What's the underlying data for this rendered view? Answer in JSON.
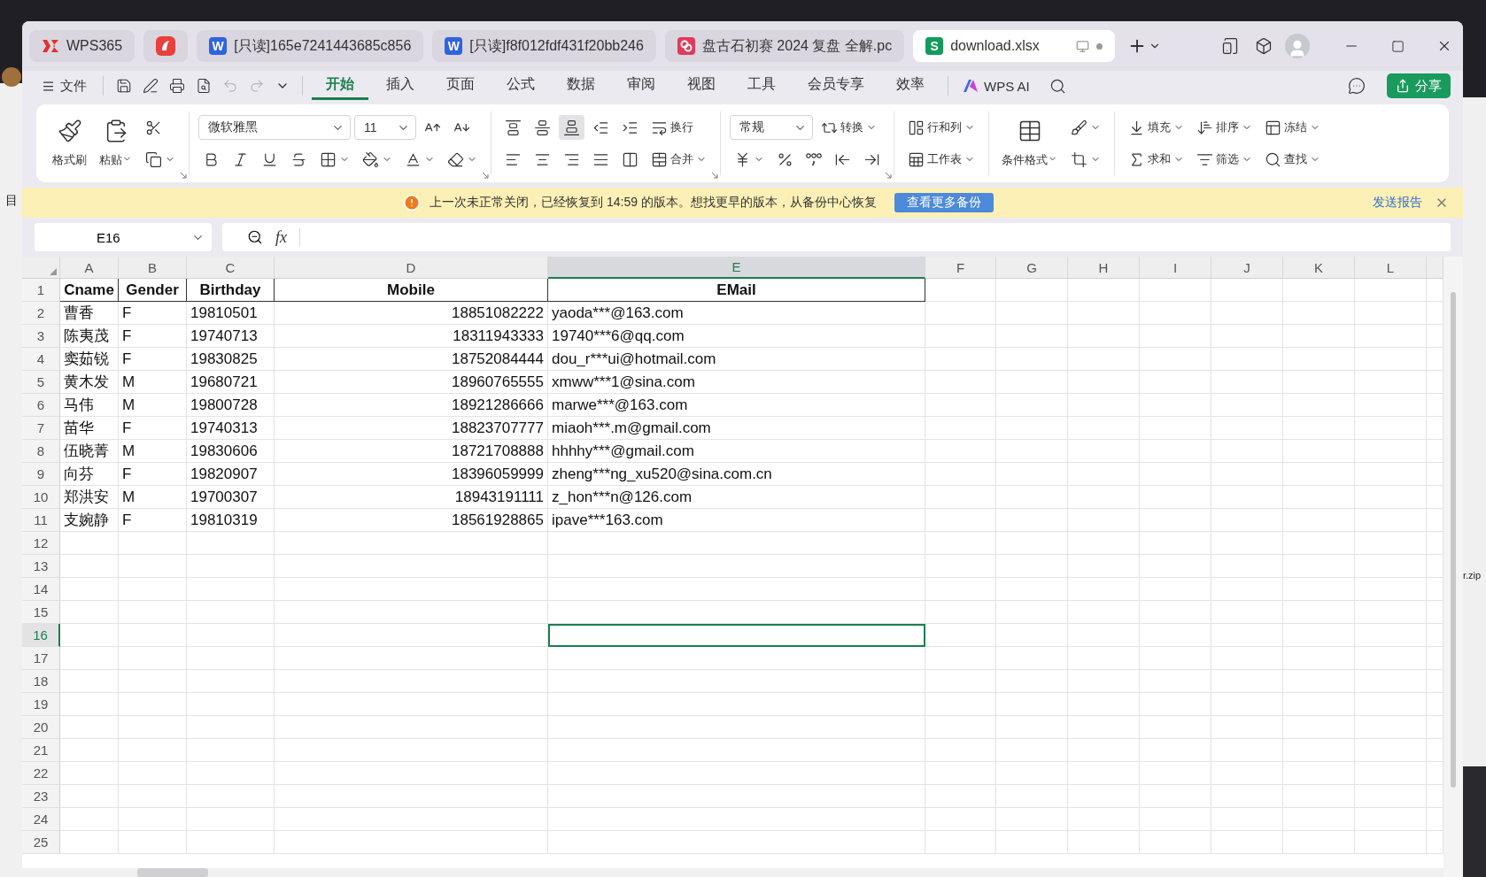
{
  "background": {
    "left_text": "目",
    "right_text": "r.zip"
  },
  "tabs": [
    {
      "kind": "home",
      "label": "WPS365",
      "selected": false
    },
    {
      "kind": "app",
      "selected": false
    },
    {
      "kind": "writer",
      "badge": "W",
      "label": "[只读]165e7241443685c856",
      "selected": false
    },
    {
      "kind": "writer",
      "badge": "W",
      "label": "[只读]f8f012fdf431f20bb246",
      "selected": false
    },
    {
      "kind": "pdf",
      "label": "盘古石初赛 2024 复盘 全解.pc",
      "selected": false
    },
    {
      "kind": "sheet",
      "badge": "S",
      "label": "download.xlsx",
      "selected": true
    }
  ],
  "menu": {
    "file": "文件",
    "items": [
      {
        "label": "开始",
        "selected": true
      },
      {
        "label": "插入",
        "selected": false
      },
      {
        "label": "页面",
        "selected": false
      },
      {
        "label": "公式",
        "selected": false
      },
      {
        "label": "数据",
        "selected": false
      },
      {
        "label": "审阅",
        "selected": false
      },
      {
        "label": "视图",
        "selected": false
      },
      {
        "label": "工具",
        "selected": false
      },
      {
        "label": "会员专享",
        "selected": false
      },
      {
        "label": "效率",
        "selected": false
      }
    ],
    "ai": "WPS AI",
    "share": "分享"
  },
  "ribbon": [
    {
      "launcher": true,
      "large": [
        {
          "label": "格式刷",
          "dropdown": false
        },
        {
          "label": "粘贴",
          "dropdown": true
        }
      ],
      "top": [
        {
          "kind": "button",
          "dropdown": false
        }
      ],
      "bottom": [
        {
          "kind": "button",
          "dropdown": true
        }
      ]
    },
    {
      "launcher": true,
      "top": [
        {
          "kind": "select",
          "value": "微软雅黑"
        },
        {
          "kind": "select",
          "value": "11"
        },
        {
          "kind": "button",
          "dropdown": false
        },
        {
          "kind": "button",
          "dropdown": false
        }
      ],
      "bottom": [
        {
          "kind": "button",
          "dropdown": false
        },
        {
          "kind": "button",
          "dropdown": false
        },
        {
          "kind": "button",
          "dropdown": false
        },
        {
          "kind": "button",
          "dropdown": false
        },
        {
          "kind": "button",
          "dropdown": true
        },
        {
          "kind": "button",
          "dropdown": true
        },
        {
          "kind": "button",
          "dropdown": true
        },
        {
          "kind": "button",
          "dropdown": true
        }
      ]
    },
    {
      "launcher": true,
      "top": [
        {
          "kind": "button",
          "dropdown": false,
          "selected": false
        },
        {
          "kind": "button",
          "dropdown": false,
          "selected": false
        },
        {
          "kind": "button",
          "dropdown": false,
          "selected": true
        },
        {
          "kind": "button",
          "dropdown": false
        },
        {
          "kind": "button",
          "dropdown": false
        },
        {
          "kind": "button",
          "label": "换行",
          "dropdown": false
        }
      ],
      "bottom": [
        {
          "kind": "button",
          "dropdown": false
        },
        {
          "kind": "button",
          "dropdown": false
        },
        {
          "kind": "button",
          "dropdown": false
        },
        {
          "kind": "button",
          "dropdown": false
        },
        {
          "kind": "button",
          "dropdown": false
        },
        {
          "kind": "button",
          "label": "合并",
          "dropdown": true
        }
      ]
    },
    {
      "launcher": true,
      "top": [
        {
          "kind": "select",
          "value": "常规"
        },
        {
          "kind": "button",
          "label": "转换",
          "dropdown": true
        }
      ],
      "bottom": [
        {
          "kind": "button",
          "dropdown": true
        },
        {
          "kind": "button",
          "dropdown": false
        },
        {
          "kind": "button",
          "dropdown": false
        },
        {
          "kind": "button",
          "dropdown": false
        },
        {
          "kind": "button",
          "dropdown": false
        }
      ]
    },
    {
      "launcher": false,
      "top": [
        {
          "kind": "button",
          "label": "行和列",
          "dropdown": true
        }
      ],
      "bottom": [
        {
          "kind": "button",
          "label": "工作表",
          "dropdown": true
        }
      ]
    },
    {
      "launcher": false,
      "large": [
        {
          "label": "条件格式",
          "dropdown": true
        }
      ],
      "top": [
        {
          "kind": "button",
          "dropdown": true
        }
      ],
      "bottom": [
        {
          "kind": "button",
          "dropdown": true
        }
      ]
    },
    {
      "launcher": false,
      "top": [
        {
          "kind": "button",
          "label": "填充",
          "dropdown": true
        },
        {
          "kind": "button",
          "label": "排序",
          "dropdown": true
        },
        {
          "kind": "button",
          "label": "冻结",
          "dropdown": true
        }
      ],
      "bottom": [
        {
          "kind": "button",
          "label": "求和",
          "dropdown": true
        },
        {
          "kind": "button",
          "label": "筛选",
          "dropdown": true
        },
        {
          "kind": "button",
          "label": "查找",
          "dropdown": true
        }
      ]
    }
  ],
  "notice": {
    "text": "上一次未正常关闭，已经恢复到 14:59 的版本。想找更早的版本，从备份中心恢复",
    "button": "查看更多备份",
    "link": "发送报告"
  },
  "formula_bar": {
    "name_box": "E16",
    "fx": "fx"
  },
  "sheet": {
    "columns": [
      {
        "label": "A",
        "selected": false
      },
      {
        "label": "B",
        "selected": false
      },
      {
        "label": "C",
        "selected": false
      },
      {
        "label": "D",
        "selected": false
      },
      {
        "label": "E",
        "selected": true
      },
      {
        "label": "F",
        "selected": false
      },
      {
        "label": "G",
        "selected": false
      },
      {
        "label": "H",
        "selected": false
      },
      {
        "label": "I",
        "selected": false
      },
      {
        "label": "J",
        "selected": false
      },
      {
        "label": "K",
        "selected": false
      },
      {
        "label": "L",
        "selected": false
      }
    ],
    "rows": [
      {
        "number": "1",
        "kind": "header",
        "selected": false,
        "cells": [
          "Cname",
          "Gender",
          "Birthday",
          "Mobile",
          "EMail"
        ]
      },
      {
        "number": "2",
        "kind": "data",
        "selected": false,
        "cells": [
          "曹香",
          "F",
          "19810501",
          "18851082222",
          "yaoda***@163.com"
        ]
      },
      {
        "number": "3",
        "kind": "data",
        "selected": false,
        "cells": [
          "陈夷茂",
          "F",
          "19740713",
          "18311943333",
          "19740***6@qq.com"
        ]
      },
      {
        "number": "4",
        "kind": "data",
        "selected": false,
        "cells": [
          "窦茹锐",
          "F",
          "19830825",
          "18752084444",
          "dou_r***ui@hotmail.com"
        ]
      },
      {
        "number": "5",
        "kind": "data",
        "selected": false,
        "cells": [
          "黄木发",
          "M",
          "19680721",
          "18960765555",
          "xmww***1@sina.com"
        ]
      },
      {
        "number": "6",
        "kind": "data",
        "selected": false,
        "cells": [
          "马伟",
          "M",
          "19800728",
          "18921286666",
          "marwe***@163.com"
        ]
      },
      {
        "number": "7",
        "kind": "data",
        "selected": false,
        "cells": [
          "苗华",
          "F",
          "19740313",
          "18823707777",
          "miaoh***.m@gmail.com"
        ]
      },
      {
        "number": "8",
        "kind": "data",
        "selected": false,
        "cells": [
          "伍晓菁",
          "M",
          "19830606",
          "18721708888",
          "hhhhy***@gmail.com"
        ]
      },
      {
        "number": "9",
        "kind": "data",
        "selected": false,
        "cells": [
          "向芬",
          "F",
          "19820907",
          "18396059999",
          "zheng***ng_xu520@sina.com.cn"
        ]
      },
      {
        "number": "10",
        "kind": "data",
        "selected": false,
        "cells": [
          "郑洪安",
          "M",
          "19700307",
          "18943191111",
          "z_hon***n@126.com"
        ]
      },
      {
        "number": "11",
        "kind": "data",
        "selected": false,
        "cells": [
          "支婉静",
          "F",
          "19810319",
          "18561928865",
          "ipave***163.com"
        ]
      },
      {
        "number": "12",
        "kind": "data",
        "selected": false
      },
      {
        "number": "13",
        "kind": "data",
        "selected": false
      },
      {
        "number": "14",
        "kind": "data",
        "selected": false
      },
      {
        "number": "15",
        "kind": "data",
        "selected": false
      },
      {
        "number": "16",
        "kind": "data",
        "selected": true
      },
      {
        "number": "17",
        "kind": "data",
        "selected": false
      },
      {
        "number": "18",
        "kind": "data",
        "selected": false
      },
      {
        "number": "19",
        "kind": "data",
        "selected": false
      },
      {
        "number": "20",
        "kind": "data",
        "selected": false
      },
      {
        "number": "21",
        "kind": "data",
        "selected": false
      },
      {
        "number": "22",
        "kind": "data",
        "selected": false
      },
      {
        "number": "23",
        "kind": "data",
        "selected": false
      },
      {
        "number": "24",
        "kind": "data",
        "selected": false
      },
      {
        "number": "25",
        "kind": "data",
        "selected": false
      }
    ]
  }
}
